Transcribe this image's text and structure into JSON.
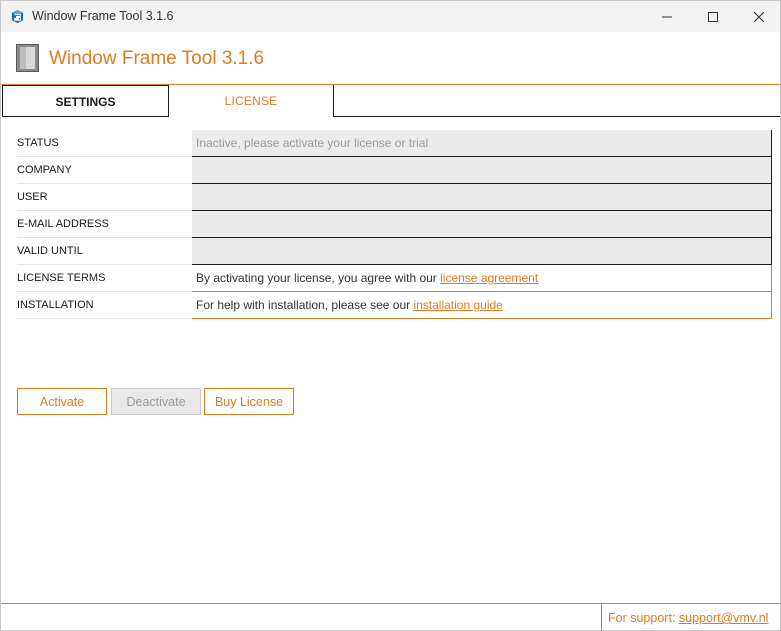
{
  "window": {
    "title": "Window Frame Tool 3.1.6",
    "controls": {
      "minimize": "minimize",
      "maximize": "maximize",
      "close": "close"
    }
  },
  "header": {
    "title": "Window Frame Tool 3.1.6",
    "icon": "window-frame-icon"
  },
  "tabs": [
    {
      "label": "SETTINGS",
      "active": false
    },
    {
      "label": "LICENSE",
      "active": true
    }
  ],
  "license": {
    "fields": [
      {
        "label": "STATUS",
        "value": "Inactive, please activate your license or trial"
      },
      {
        "label": "COMPANY",
        "value": ""
      },
      {
        "label": "USER",
        "value": ""
      },
      {
        "label": "E-MAIL ADDRESS",
        "value": ""
      },
      {
        "label": "VALID UNTIL",
        "value": ""
      }
    ],
    "terms": {
      "label": "LICENSE TERMS",
      "text": "By activating your license, you agree with our ",
      "link": "license agreement"
    },
    "installation": {
      "label": "INSTALLATION",
      "text": "For help with installation, please see our ",
      "link": "installation guide"
    }
  },
  "buttons": {
    "activate": "Activate",
    "deactivate": "Deactivate",
    "buy": "Buy License"
  },
  "footer": {
    "support_text": "For support: ",
    "support_link": "support@vmv.nl"
  },
  "colors": {
    "accent": "#e07b1f",
    "readonly_bg": "#ececec",
    "disabled_text": "#9a9a9a"
  }
}
